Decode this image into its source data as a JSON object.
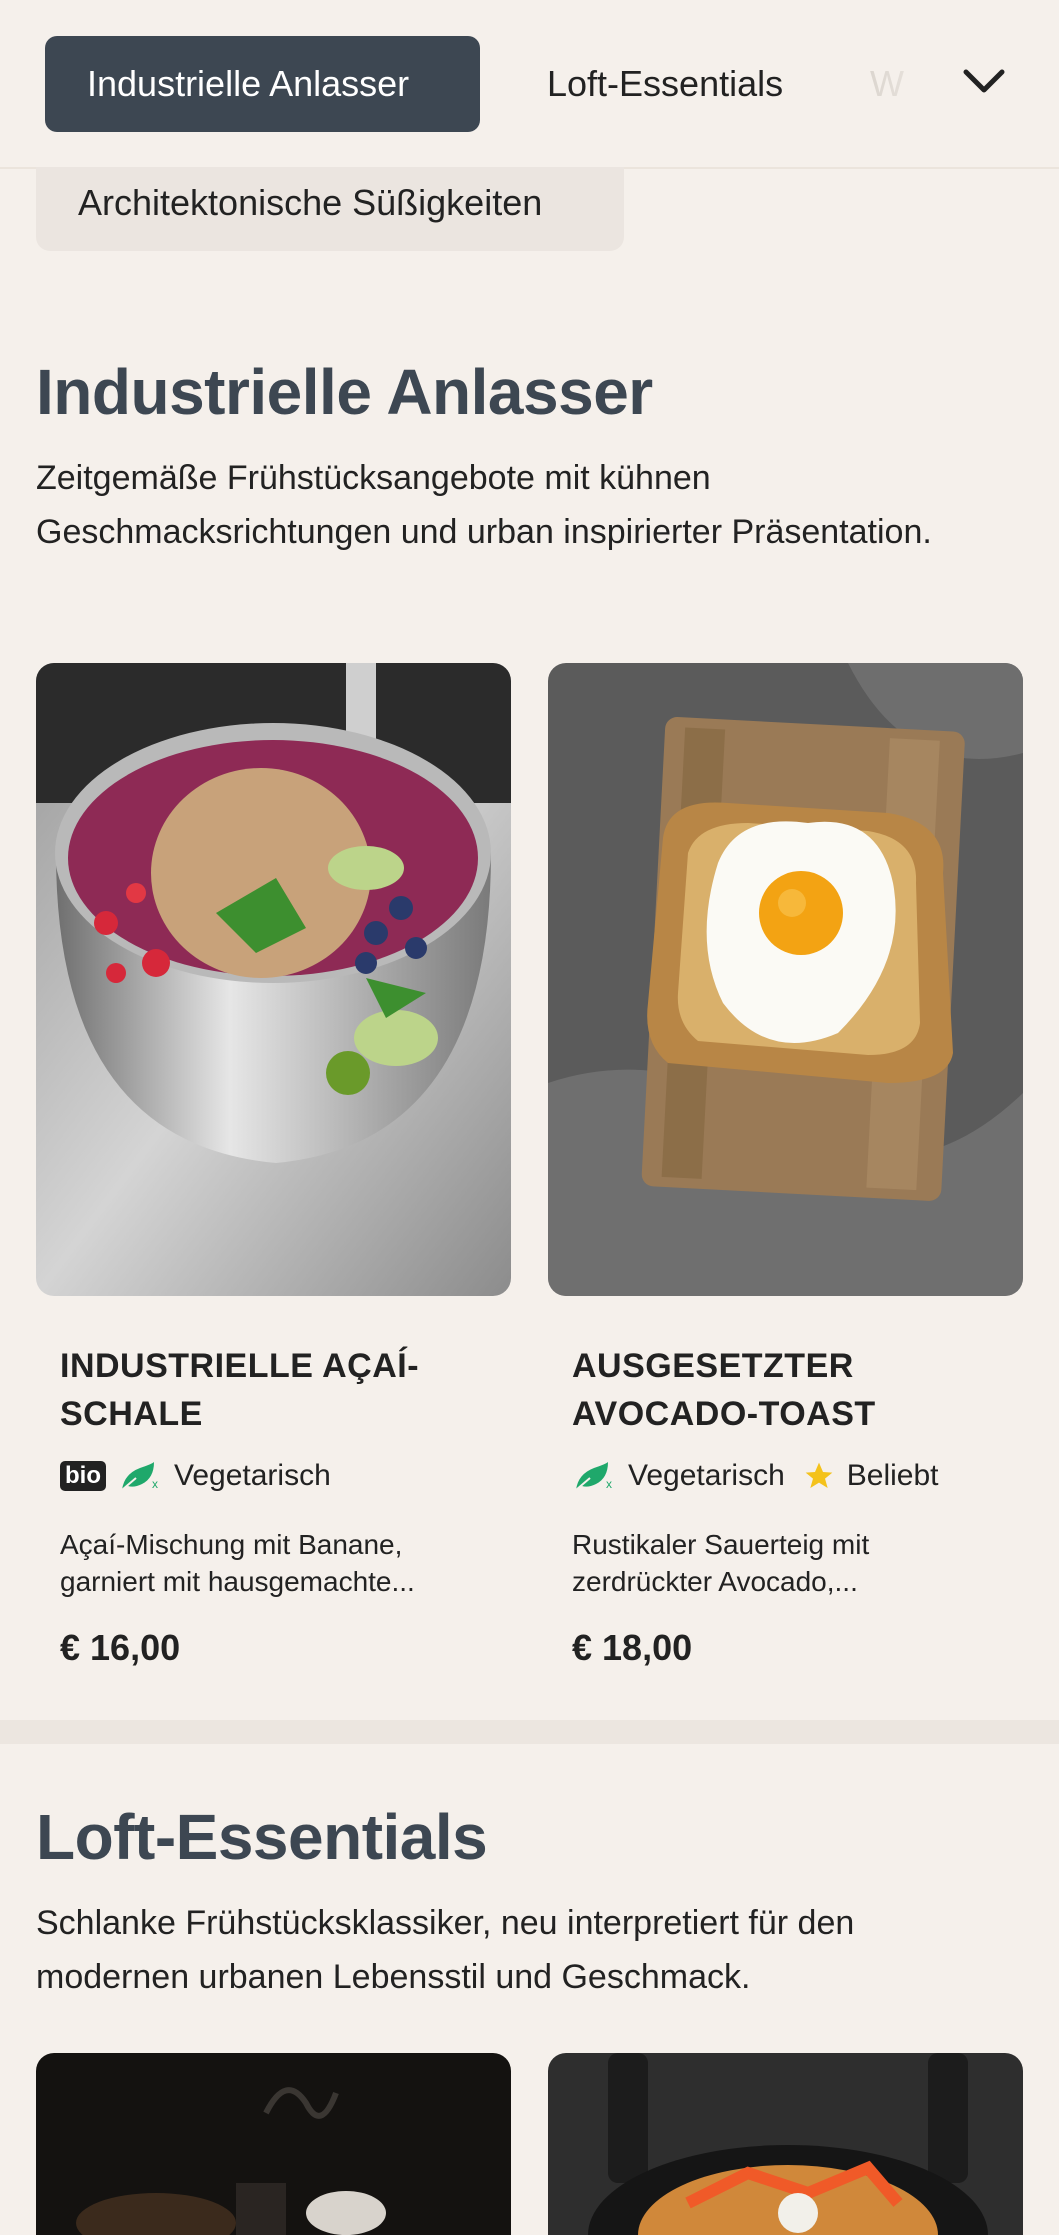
{
  "nav": {
    "tabs": [
      {
        "label": "Industrielle Anlasser",
        "active": true
      },
      {
        "label": "Loft-Essentials",
        "active": false
      },
      {
        "label": "W",
        "active": false
      }
    ],
    "overflow_tab": "Architektonische Süßigkeiten",
    "accent_color": "#3d4752"
  },
  "sections": [
    {
      "title": "Industrielle Anlasser",
      "description": "Zeitgemäße Frühstücksangebote mit kühnen Geschmacksrichtungen und urban inspirierter Präsentation.",
      "items": [
        {
          "name": "INDUSTRIELLE AÇAÍ-SCHALE",
          "badge": "bio",
          "tags": [
            "Vegetarisch"
          ],
          "description": "Açaí-Mischung mit Banane, garniert mit hausgemachte...",
          "price": "€ 16,00"
        },
        {
          "name": "AUSGESETZTER AVOCADO-TOAST",
          "tags": [
            "Vegetarisch",
            "Beliebt"
          ],
          "description": "Rustikaler Sauerteig mit zerdrückter Avocado,...",
          "price": "€ 18,00"
        }
      ]
    },
    {
      "title": "Loft-Essentials",
      "description": "Schlanke Frühstücksklassiker, neu interpretiert für den modernen urbanen Lebensstil und Geschmack."
    }
  ]
}
